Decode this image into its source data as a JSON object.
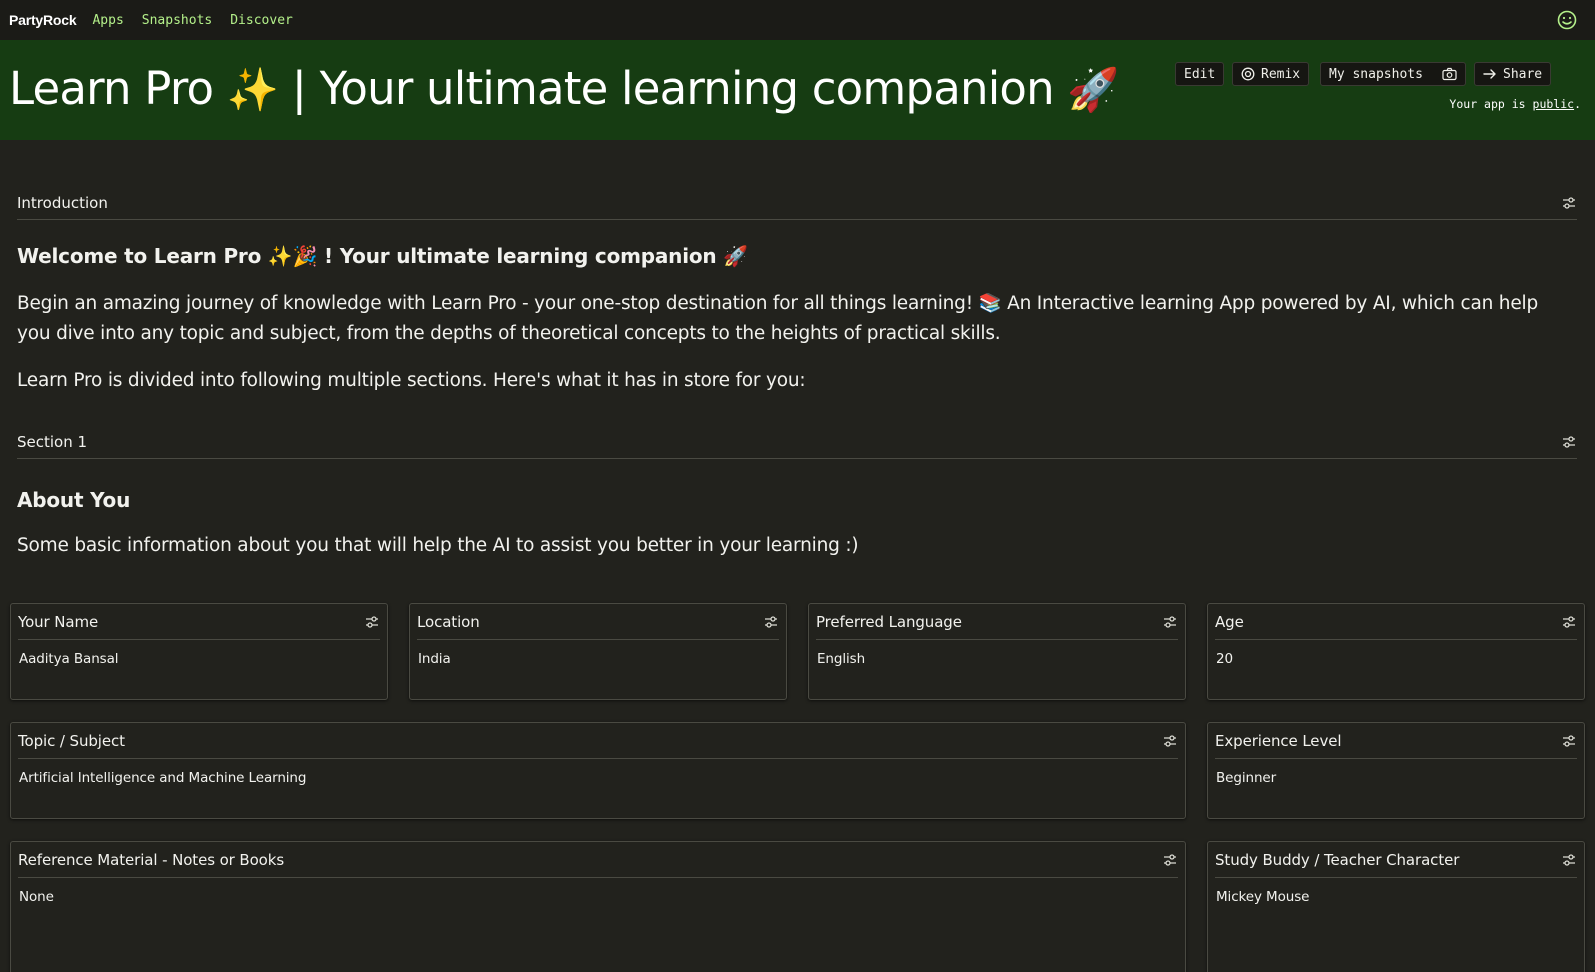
{
  "nav": {
    "brand": "PartyRock",
    "links": [
      "Apps",
      "Snapshots",
      "Discover"
    ]
  },
  "header": {
    "title_part1": "Learn Pro ",
    "title_emoji1": "✨",
    "title_part2": " | Your ultimate learning companion ",
    "title_emoji2": "🚀",
    "buttons": {
      "edit": "Edit",
      "remix": "Remix",
      "snapshots": "My snapshots",
      "share": "Share"
    },
    "public_prefix": "Your app is ",
    "public_link": "public",
    "public_suffix": "."
  },
  "introduction": {
    "label": "Introduction",
    "heading": "Welcome to Learn Pro ✨🎉 ! Your ultimate learning companion 🚀",
    "paragraph": "Begin an amazing journey of knowledge with Learn Pro - your one-stop destination for all things learning! 📚 An Interactive learning App powered by AI, which can help you dive into any topic and subject, from the depths of theoretical concepts to the heights of practical skills.",
    "paragraph2": "Learn Pro is divided into following multiple sections. Here's what it has in store for you:"
  },
  "section1": {
    "label": "Section 1",
    "heading": "About You",
    "paragraph": "Some basic information about you that will help the AI to assist you better in your learning :)"
  },
  "fields": {
    "name": {
      "label": "Your Name",
      "value": "Aaditya Bansal"
    },
    "location": {
      "label": "Location",
      "value": "India"
    },
    "language": {
      "label": "Preferred Language",
      "value": "English"
    },
    "age": {
      "label": "Age",
      "value": "20"
    },
    "topic": {
      "label": "Topic / Subject",
      "value": "Artificial Intelligence and Machine Learning"
    },
    "experience": {
      "label": "Experience Level",
      "value": "Beginner"
    },
    "reference": {
      "label": "Reference Material - Notes or Books",
      "value": "None"
    },
    "buddy": {
      "label": "Study Buddy / Teacher Character",
      "value": "Mickey Mouse"
    }
  },
  "colors": {
    "background": "#22221d",
    "header_green": "#163c12",
    "nav_link": "#b4f08a"
  },
  "icons": [
    "smiley-icon",
    "remix-icon",
    "camera-icon",
    "share-arrow-icon",
    "tune-icon"
  ]
}
